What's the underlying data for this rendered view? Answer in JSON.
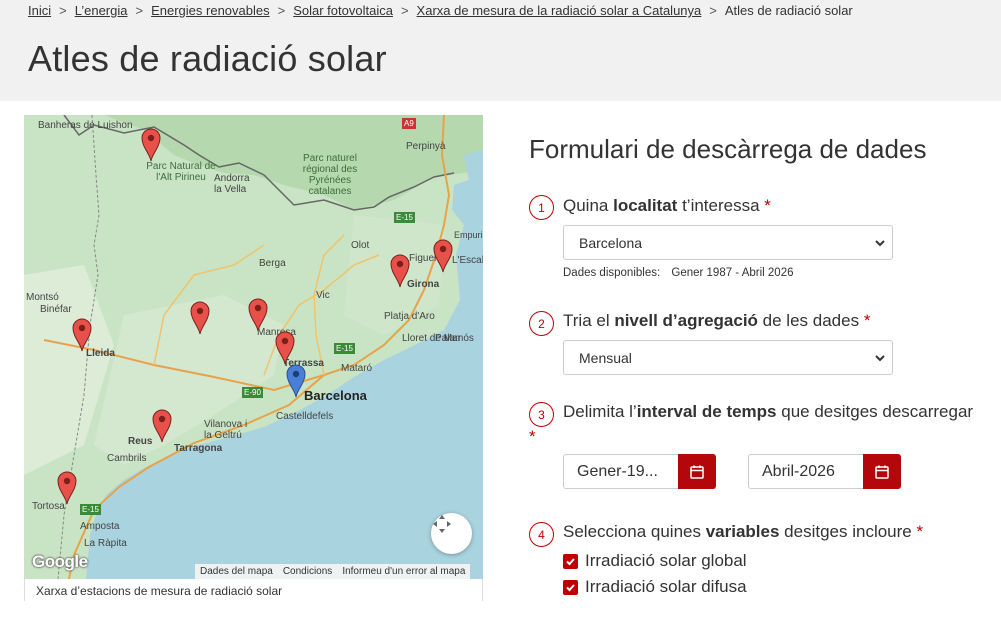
{
  "breadcrumb": {
    "items": [
      "Inici",
      "L’energia",
      "Energies renovables",
      "Solar fotovoltaica",
      "Xarxa de mesura de la radiació solar a Catalunya"
    ],
    "current": "Atles de radiació solar",
    "separator": ">"
  },
  "page_title": "Atles de radiació solar",
  "map": {
    "labels": {
      "banheras": "Banheras de Luishon",
      "parc_pirineu": "Parc Natural de l'Alt Pirineu",
      "andorra": "Andorra la Vella",
      "parc_pyrenees": "Parc naturel régional des Pyrénées catalanes",
      "perpinya": "Perpinyà",
      "a9": "A9",
      "olot": "Olot",
      "berga": "Berga",
      "figueres": "Figueres",
      "empuria": "Empuriabrava",
      "lescala": "L'Escala",
      "girona": "Girona",
      "vic": "Vic",
      "montso": "Montsó",
      "binefar": "Binéfar",
      "lleida": "Lleida",
      "manresa": "Manresa",
      "platja": "Platja d'Aro",
      "palamos": "Palamós",
      "lloret": "Lloret de Mar",
      "e15_n": "E-15",
      "e15_c": "E-15",
      "e15_s": "E-15",
      "e90": "E-90",
      "terrassa": "Terrassa",
      "mataro": "Mataró",
      "barcelona": "Barcelona",
      "castelldefels": "Castelldefels",
      "vilanova": "Vilanova i la Geltrú",
      "reus": "Reus",
      "tarragona": "Tarragona",
      "cambrils": "Cambrils",
      "tortosa": "Tortosa",
      "amposta": "Amposta",
      "rapita": "La Ràpita"
    },
    "google_logo": "Google",
    "footer": [
      "Dades del mapa",
      "Condicions",
      "Informeu d'un error al mapa"
    ],
    "caption": "Xarxa d’estacions de mesura de radiació solar",
    "pin_colors": {
      "station": "#e8514a",
      "selected": "#4a7fd8"
    }
  },
  "form": {
    "title": "Formulari de descàrrega de dades",
    "q1": {
      "num": "1",
      "pre": "Quina ",
      "bold": "localitat",
      "post": " t’interessa",
      "req": "*",
      "selected": "Barcelona",
      "avail_label": "Dades disponibles:",
      "avail_value": "Gener 1987 - Abril 2026"
    },
    "q2": {
      "num": "2",
      "pre": "Tria el ",
      "bold": "nivell d’agregació",
      "post": " de les dades",
      "req": "*",
      "selected": "Mensual"
    },
    "q3": {
      "num": "3",
      "pre": "Delimita l’",
      "bold": "interval de temps",
      "post": " que desitges descarregar",
      "req": "*",
      "start": "Gener-19...",
      "end": "Abril-2026"
    },
    "q4": {
      "num": "4",
      "pre": "Selecciona quines ",
      "bold": "variables",
      "post": " desitges incloure",
      "req": "*",
      "options": [
        "Irradiació solar global",
        "Irradiació solar difusa"
      ]
    }
  },
  "colors": {
    "accent": "#c00000",
    "button": "#b3070b",
    "header_bg": "#f1f1f1"
  }
}
